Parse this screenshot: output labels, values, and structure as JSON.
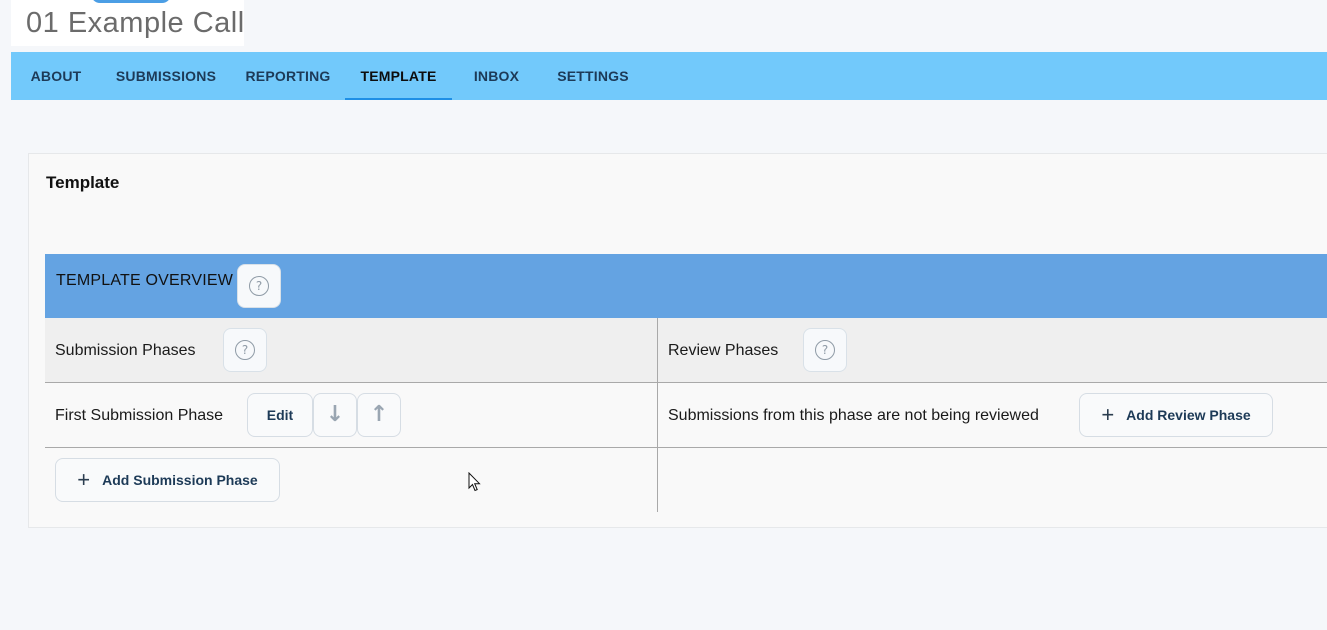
{
  "header": {
    "title": "01 Example Call"
  },
  "nav": {
    "tabs": [
      {
        "label": "ABOUT"
      },
      {
        "label": "SUBMISSIONS"
      },
      {
        "label": "REPORTING"
      },
      {
        "label": "TEMPLATE"
      },
      {
        "label": "INBOX"
      },
      {
        "label": "SETTINGS"
      }
    ],
    "active": "TEMPLATE"
  },
  "card": {
    "title": "Template",
    "overview": {
      "label": "TEMPLATE OVERVIEW",
      "help_icon": "question-circle-icon"
    },
    "columns": {
      "submission_phases": "Submission Phases",
      "review_phases": "Review Phases"
    },
    "rows": [
      {
        "phase_name": "First Submission Phase",
        "edit_label": "Edit",
        "move_down_icon": "arrow-down-icon",
        "move_up_icon": "arrow-up-icon",
        "review_status": "Submissions from this phase are not being reviewed",
        "add_review_label": "Add Review Phase"
      }
    ],
    "add_submission_label": "Add Submission Phase"
  },
  "colors": {
    "nav_bg": "#72c9fb",
    "overview_bg": "#64a3e2",
    "active_underline": "#1e8fe6",
    "button_text": "#1d3a57"
  }
}
